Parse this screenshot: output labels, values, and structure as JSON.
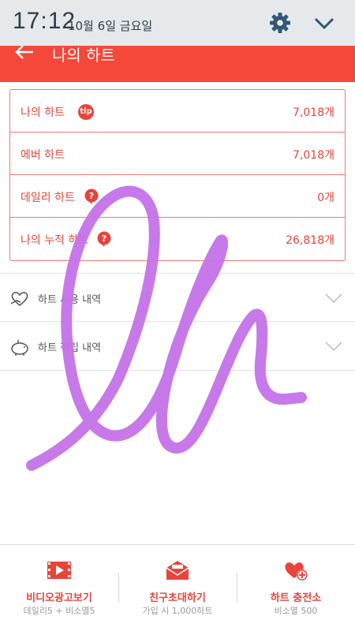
{
  "status_bar": {
    "time": "17:12",
    "date": "10월 6일 금요일",
    "icons": [
      "gear-icon",
      "chevron-down-icon"
    ]
  },
  "app_bar": {
    "title": "나의 하트",
    "back_icon": "arrow-left-icon",
    "color": "#f5473a"
  },
  "summary": {
    "rows": [
      {
        "label": "나의 하트",
        "value": "7,018개",
        "badge": "tip"
      },
      {
        "label": "에버 하트",
        "value": "7,018개",
        "badge": ""
      },
      {
        "label": "데일리 하트",
        "value": "0개",
        "badge": "?"
      },
      {
        "label": "나의 누적 하트",
        "value": "26,818개",
        "badge": "?"
      }
    ]
  },
  "history": [
    {
      "label": "하트 사용 내역",
      "icon": "heart-hand-icon"
    },
    {
      "label": "하트 적립 내역",
      "icon": "piggy-bank-icon"
    }
  ],
  "bottom_bar": {
    "items": [
      {
        "title": "비디오광고보기",
        "subtitle": "데일리5 + 비소멸5",
        "icon": "video-play-icon"
      },
      {
        "title": "친구초대하기",
        "subtitle": "가입 시 1,000하트",
        "icon": "envelope-icon"
      },
      {
        "title": "하트 충전소",
        "subtitle": "비소멸 500",
        "icon": "heart-plus-icon"
      }
    ]
  },
  "colors": {
    "accent": "#e8443a",
    "scribble": "#c472e8"
  }
}
